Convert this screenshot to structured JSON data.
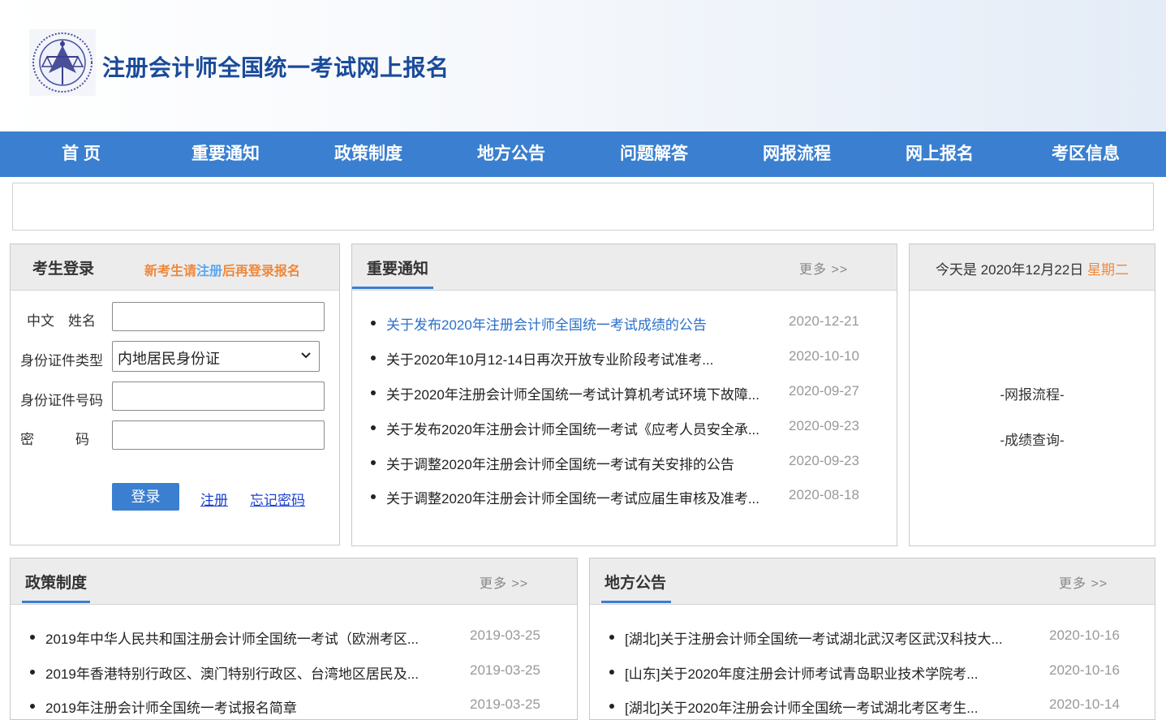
{
  "header": {
    "title": "注册会计师全国统一考试网上报名",
    "logo_icon": "cicpa-logo-icon"
  },
  "nav": [
    {
      "label": "首 页"
    },
    {
      "label": "重要通知"
    },
    {
      "label": "政策制度"
    },
    {
      "label": "地方公告"
    },
    {
      "label": "问题解答"
    },
    {
      "label": "网报流程"
    },
    {
      "label": "网上报名"
    },
    {
      "label": "考区信息"
    }
  ],
  "login": {
    "title": "考生登录",
    "hint_prefix": "新考生请",
    "hint_register": "注册",
    "hint_suffix": "后再登录报名",
    "name_label": "中文　姓名",
    "idtype_label": "身份证件类型",
    "idtype_value": "内地居民身份证",
    "idnum_label": "身份证件号码",
    "password_label": "密　　　码",
    "login_button": "登录",
    "register_link": "注册",
    "forgot_link": "忘记密码"
  },
  "notices": {
    "title": "重要通知",
    "more": "更多 >>",
    "items": [
      {
        "title": "关于发布2020年注册会计师全国统一考试成绩的公告",
        "date": "2020-12-21"
      },
      {
        "title": "关于2020年10月12-14日再次开放专业阶段考试准考...",
        "date": "2020-10-10"
      },
      {
        "title": "关于2020年注册会计师全国统一考试计算机考试环境下故障...",
        "date": "2020-09-27"
      },
      {
        "title": "关于发布2020年注册会计师全国统一考试《应考人员安全承...",
        "date": "2020-09-23"
      },
      {
        "title": "关于调整2020年注册会计师全国统一考试有关安排的公告",
        "date": "2020-09-23"
      },
      {
        "title": "关于调整2020年注册会计师全国统一考试应届生审核及准考...",
        "date": "2020-08-18"
      }
    ]
  },
  "today": {
    "prefix": "今天是 2020年12月22日",
    "weekday": "星期二",
    "link1": "-网报流程-",
    "link2": "-成绩查询-"
  },
  "policy": {
    "title": "政策制度",
    "more": "更多 >>",
    "items": [
      {
        "title": "2019年中华人民共和国注册会计师全国统一考试（欧洲考区...",
        "date": "2019-03-25"
      },
      {
        "title": "2019年香港特别行政区、澳门特别行政区、台湾地区居民及...",
        "date": "2019-03-25"
      },
      {
        "title": "2019年注册会计师全国统一考试报名简章",
        "date": "2019-03-25"
      }
    ]
  },
  "local": {
    "title": "地方公告",
    "more": "更多 >>",
    "items": [
      {
        "title": "[湖北]关于注册会计师全国统一考试湖北武汉考区武汉科技大...",
        "date": "2020-10-16"
      },
      {
        "title": "[山东]关于2020年度注册会计师考试青岛职业技术学院考...",
        "date": "2020-10-16"
      },
      {
        "title": "[湖北]关于2020年注册会计师全国统一考试湖北考区考生...",
        "date": "2020-10-14"
      }
    ]
  },
  "colors": {
    "nav_bg": "#3a7fd0",
    "title_blue": "#1a4a9a",
    "accent_orange": "#f0873a",
    "link_blue": "#2a6fc9"
  }
}
